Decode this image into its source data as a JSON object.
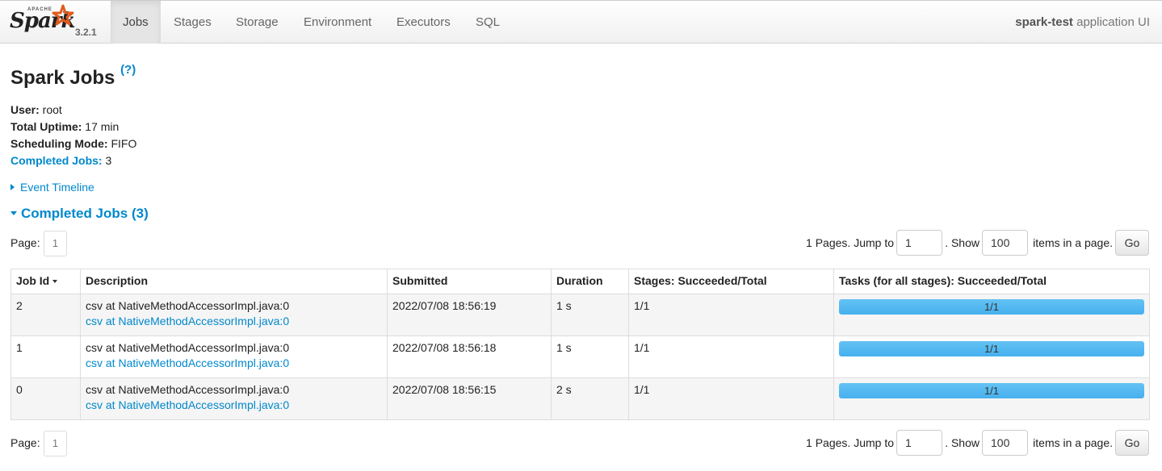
{
  "navbar": {
    "logo_small": "APACHE",
    "logo_word": "Spark",
    "version": "3.2.1",
    "tabs": [
      {
        "label": "Jobs",
        "active": true
      },
      {
        "label": "Stages",
        "active": false
      },
      {
        "label": "Storage",
        "active": false
      },
      {
        "label": "Environment",
        "active": false
      },
      {
        "label": "Executors",
        "active": false
      },
      {
        "label": "SQL",
        "active": false
      }
    ],
    "app_name": "spark-test",
    "app_suffix": " application UI"
  },
  "page": {
    "title": "Spark Jobs",
    "help": "(?)"
  },
  "summary": {
    "user_label": "User:",
    "user_value": " root",
    "uptime_label": "Total Uptime:",
    "uptime_value": " 17 min",
    "mode_label": "Scheduling Mode:",
    "mode_value": " FIFO",
    "completed_label": "Completed Jobs:",
    "completed_value": " 3"
  },
  "timeline": {
    "label": "Event Timeline"
  },
  "completed_section": {
    "label": "Completed Jobs (3)"
  },
  "pager": {
    "page_label": "Page:",
    "page_number": "1",
    "pages_text": "1 Pages. Jump to",
    "jump_value": "1",
    "show_text": ". Show",
    "show_value": "100",
    "items_text": "items in a page.",
    "go_label": "Go"
  },
  "table": {
    "headers": [
      "Job Id",
      "Description",
      "Submitted",
      "Duration",
      "Stages: Succeeded/Total",
      "Tasks (for all stages): Succeeded/Total"
    ],
    "rows": [
      {
        "id": "2",
        "desc": "csv at NativeMethodAccessorImpl.java:0",
        "desc_link": "csv at NativeMethodAccessorImpl.java:0",
        "submitted": "2022/07/08 18:56:19",
        "duration": "1 s",
        "stages": "1/1",
        "tasks": "1/1",
        "tasks_fraction": 1.0
      },
      {
        "id": "1",
        "desc": "csv at NativeMethodAccessorImpl.java:0",
        "desc_link": "csv at NativeMethodAccessorImpl.java:0",
        "submitted": "2022/07/08 18:56:18",
        "duration": "1 s",
        "stages": "1/1",
        "tasks": "1/1",
        "tasks_fraction": 1.0
      },
      {
        "id": "0",
        "desc": "csv at NativeMethodAccessorImpl.java:0",
        "desc_link": "csv at NativeMethodAccessorImpl.java:0",
        "submitted": "2022/07/08 18:56:15",
        "duration": "2 s",
        "stages": "1/1",
        "tasks": "1/1",
        "tasks_fraction": 1.0
      }
    ]
  },
  "colors": {
    "link": "#0088cc",
    "progress": "#5ab9f2",
    "row_alt": "#f5f5f5"
  }
}
